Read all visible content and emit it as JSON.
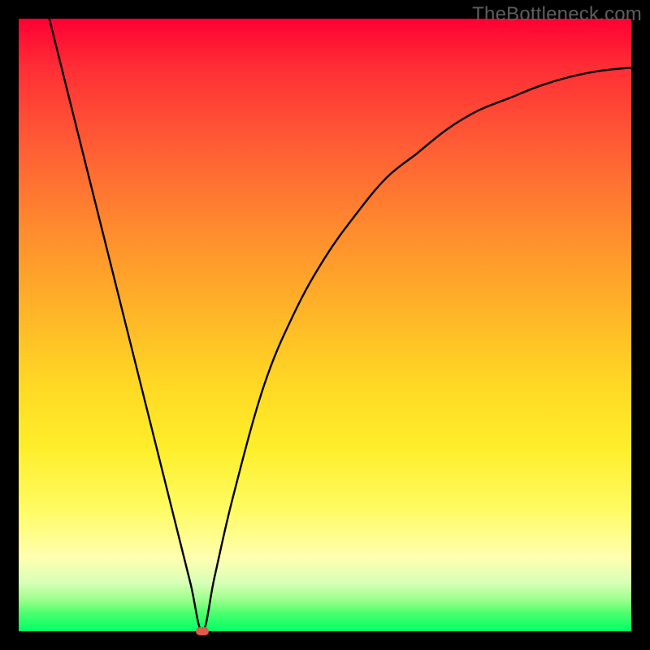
{
  "watermark": "TheBottleneck.com",
  "chart_data": {
    "type": "line",
    "title": "",
    "xlabel": "",
    "ylabel": "",
    "xlim": [
      0,
      100
    ],
    "ylim": [
      0,
      100
    ],
    "grid": false,
    "legend": false,
    "series": [
      {
        "name": "bottleneck-curve",
        "x": [
          5,
          10,
          15,
          20,
          25,
          28,
          30,
          32,
          35,
          40,
          45,
          50,
          55,
          60,
          65,
          70,
          75,
          80,
          85,
          90,
          95,
          100
        ],
        "y": [
          100,
          80,
          60,
          40,
          20,
          8,
          0,
          9,
          22,
          40,
          52,
          61,
          68,
          74,
          78,
          82,
          85,
          87,
          89,
          90.5,
          91.5,
          92
        ]
      }
    ],
    "marker": {
      "x": 30,
      "y": 0,
      "color": "#e05a4a"
    },
    "background_gradient": {
      "stops": [
        {
          "pos": 0.0,
          "color": "#ff0033"
        },
        {
          "pos": 0.2,
          "color": "#ff5a35"
        },
        {
          "pos": 0.48,
          "color": "#ffb528"
        },
        {
          "pos": 0.7,
          "color": "#feee2a"
        },
        {
          "pos": 0.88,
          "color": "#ffffb0"
        },
        {
          "pos": 1.0,
          "color": "#00ff66"
        }
      ]
    },
    "frame_color": "#000000"
  }
}
